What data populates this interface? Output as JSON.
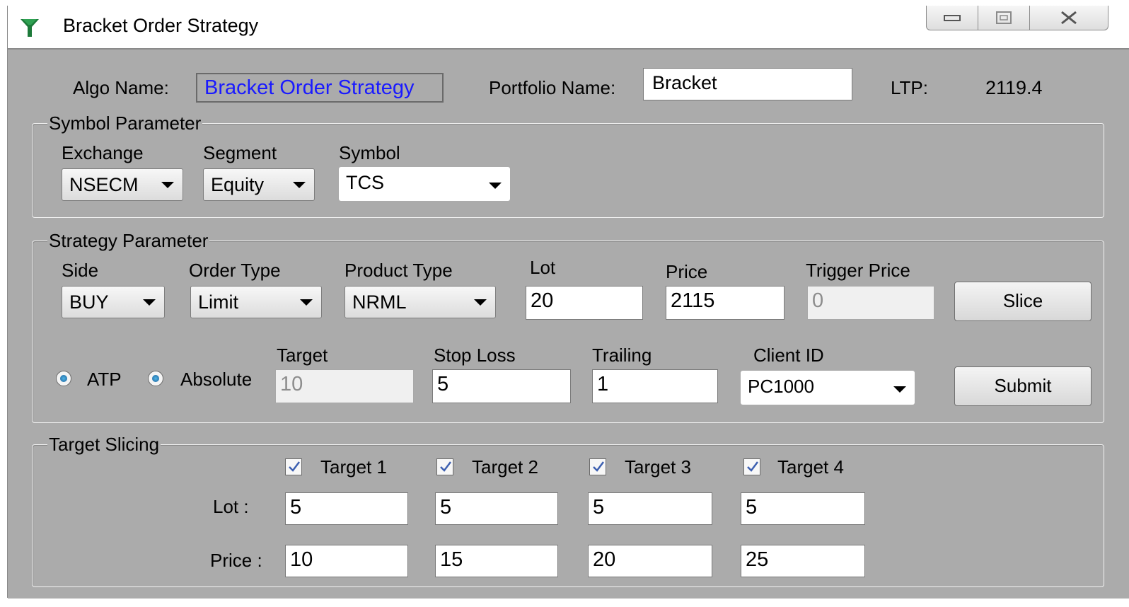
{
  "window": {
    "title": "Bracket Order Strategy"
  },
  "header": {
    "algo_label": "Algo Name:",
    "algo_value": "Bracket Order Strategy",
    "portfolio_label": "Portfolio Name:",
    "portfolio_value": "Bracket",
    "ltp_label": "LTP:",
    "ltp_value": "2119.4"
  },
  "symbol_parameter": {
    "title": "Symbol Parameter",
    "exchange_label": "Exchange",
    "exchange_value": "NSECM",
    "segment_label": "Segment",
    "segment_value": "Equity",
    "symbol_label": "Symbol",
    "symbol_value": "TCS"
  },
  "strategy_parameter": {
    "title": "Strategy Parameter",
    "side_label": "Side",
    "side_value": "BUY",
    "order_type_label": "Order Type",
    "order_type_value": "Limit",
    "product_type_label": "Product Type",
    "product_type_value": "NRML",
    "lot_label": "Lot",
    "lot_value": "20",
    "price_label": "Price",
    "price_value": "2115",
    "trigger_label": "Trigger Price",
    "trigger_value": "0",
    "slice_button": "Slice",
    "atp_label": "ATP",
    "absolute_label": "Absolute",
    "target_label": "Target",
    "target_value": "10",
    "stoploss_label": "Stop Loss",
    "stoploss_value": "5",
    "trailing_label": "Trailing",
    "trailing_value": "1",
    "client_label": "Client ID",
    "client_value": "PC1000",
    "submit_button": "Submit"
  },
  "target_slicing": {
    "title": "Target Slicing",
    "lot_row_label": "Lot :",
    "price_row_label": "Price :",
    "targets": [
      {
        "label": "Target 1",
        "checked": true,
        "lot": "5",
        "price": "10"
      },
      {
        "label": "Target 2",
        "checked": true,
        "lot": "5",
        "price": "15"
      },
      {
        "label": "Target 3",
        "checked": true,
        "lot": "5",
        "price": "20"
      },
      {
        "label": "Target 4",
        "checked": true,
        "lot": "5",
        "price": "25"
      }
    ]
  },
  "colors": {
    "window_bg": "#ababab",
    "algo_text": "#1a1aff"
  }
}
